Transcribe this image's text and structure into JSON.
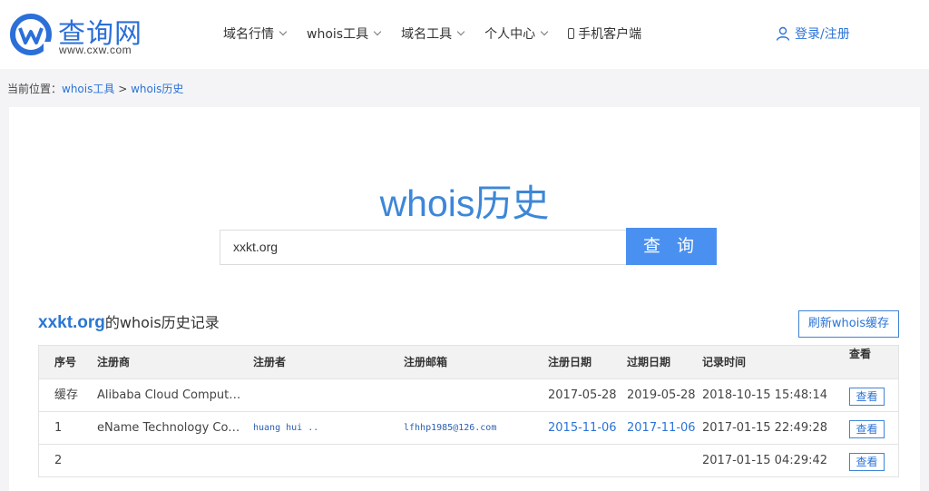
{
  "logo": {
    "cn": "查询网",
    "en": "www.cxw.com"
  },
  "nav": [
    {
      "label": "域名行情"
    },
    {
      "label": "whois工具"
    },
    {
      "label": "域名工具"
    },
    {
      "label": "个人中心"
    }
  ],
  "mobile_label": "手机客户端",
  "login_label": "登录/注册",
  "breadcrumb": {
    "prefix": "当前位置：",
    "home": "whois工具",
    "sep": " > ",
    "current": "whois历史"
  },
  "heading": "whois历史",
  "search": {
    "value": "xxkt.org",
    "button": "查 询"
  },
  "records": {
    "domain": "xxkt.org",
    "suffix": "的whois历史记录",
    "refresh": "刷新whois缓存"
  },
  "table": {
    "headers": [
      "序号",
      "注册商",
      "注册者",
      "注册邮箱",
      "注册日期",
      "过期日期",
      "记录时间",
      "查看"
    ],
    "rows": [
      {
        "no": "缓存",
        "registrar": "Alibaba Cloud Computin...",
        "registrant": "",
        "email": "",
        "created": "2017-05-28",
        "expires": "2019-05-28",
        "recorded": "2018-10-15 15:48:14",
        "view": "查看"
      },
      {
        "no": "1",
        "registrar": "eName Technology Co. L...",
        "registrant": "huang hui ..",
        "email": "lfhhp1985@126.com",
        "created": "2015-11-06",
        "expires": "2017-11-06",
        "recorded": "2017-01-15 22:49:28",
        "view": "查看"
      },
      {
        "no": "2",
        "registrar": "",
        "registrant": "",
        "email": "",
        "created": "",
        "expires": "",
        "recorded": "2017-01-15 04:29:42",
        "view": "查看"
      }
    ]
  },
  "colors": {
    "brand": "#2b6fd8",
    "accent": "#4a90f0",
    "link": "#2b73d9"
  },
  "icons": [
    "logo-mark-icon",
    "chevron-down-icon",
    "phone-icon",
    "user-icon"
  ]
}
